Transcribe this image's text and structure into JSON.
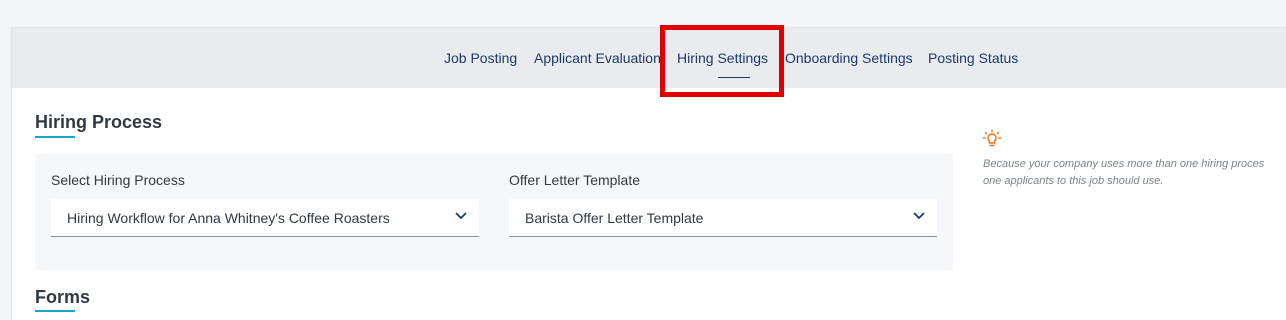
{
  "tabs": [
    {
      "label": "Job Posting"
    },
    {
      "label": "Applicant Evaluation"
    },
    {
      "label": "Hiring Settings"
    },
    {
      "label": "Onboarding Settings"
    },
    {
      "label": "Posting Status"
    }
  ],
  "active_tab": "Hiring Settings",
  "hiring_process": {
    "title": "Hiring Process",
    "select_hiring_process": {
      "label": "Select Hiring Process",
      "value": "Hiring Workflow for Anna Whitney's Coffee Roasters"
    },
    "offer_letter_template": {
      "label": "Offer Letter Template",
      "value": "Barista Offer Letter Template"
    }
  },
  "tip": {
    "icon": "lightbulb-icon",
    "line1": "Because your company uses more than one hiring proces",
    "line2": "one applicants to this job should use."
  },
  "forms": {
    "title": "Forms"
  },
  "colors": {
    "accent": "#17a6c8",
    "tab_text": "#1a3a6b",
    "highlight": "#e00000",
    "tip_icon": "#f07a1a"
  }
}
